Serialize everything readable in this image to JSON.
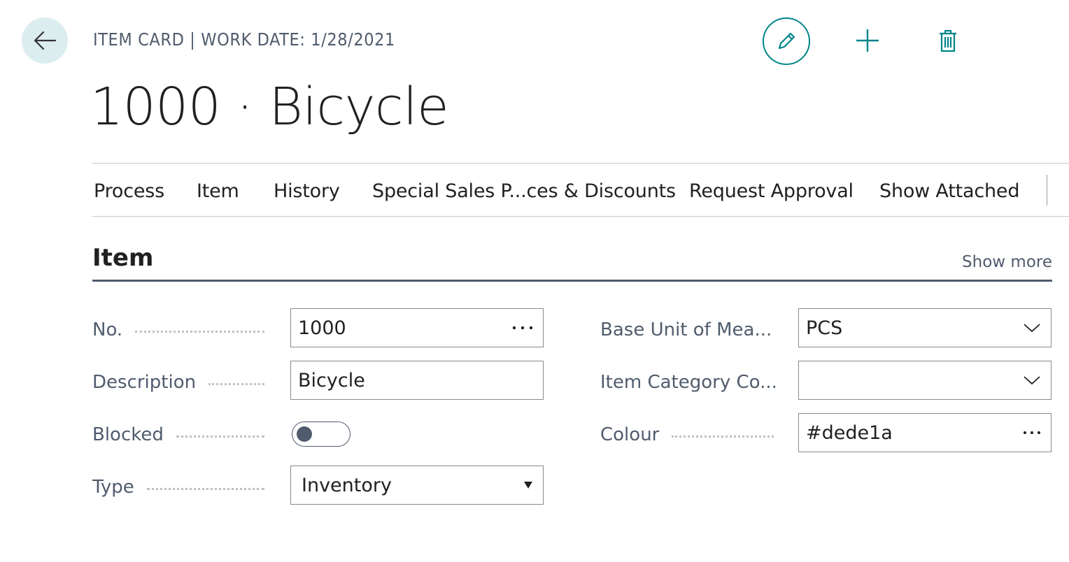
{
  "header": {
    "caption": "ITEM CARD | WORK DATE: 1/28/2021",
    "title": "1000 · Bicycle",
    "accent_color": "#008489",
    "icons": {
      "back": "back-arrow-icon",
      "edit": "pencil-icon",
      "add": "plus-icon",
      "delete": "trash-icon"
    }
  },
  "action_bar": {
    "items": [
      "Process",
      "Item",
      "History",
      "Special Sales P...ces & Discounts",
      "Request Approval",
      "Show Attached"
    ]
  },
  "group": {
    "title": "Item",
    "show_more": "Show more"
  },
  "fields": {
    "no": {
      "label": "No.",
      "value": "1000"
    },
    "description": {
      "label": "Description",
      "value": "Bicycle"
    },
    "blocked": {
      "label": "Blocked",
      "value": false
    },
    "type": {
      "label": "Type",
      "value": "Inventory"
    },
    "base_unit": {
      "label": "Base Unit of Mea...",
      "value": "PCS"
    },
    "item_category": {
      "label": "Item Category Co...",
      "value": ""
    },
    "colour": {
      "label": "Colour",
      "value": "#dede1a"
    }
  }
}
